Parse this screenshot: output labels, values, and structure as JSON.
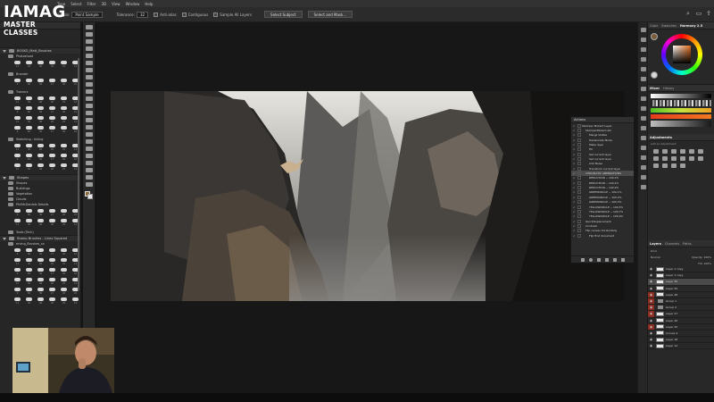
{
  "logo": {
    "line1": "IAMAG",
    "line2": "MASTER CLASSES"
  },
  "menu": [
    "Type",
    "Select",
    "Filter",
    "3D",
    "View",
    "Window",
    "Help"
  ],
  "options_bar": {
    "sample_label": "Sample:",
    "sample_value": "Point Sample",
    "tolerance_label": "Tolerance:",
    "tolerance_value": "32",
    "antialias": "Anti-alias",
    "contiguous": "Contiguous",
    "sample_all": "Sample All Layers",
    "select_subject": "Select Subject",
    "select_mask": "Select and Mask..."
  },
  "brush_panel": {
    "groups": [
      {
        "label": "BOSKO_Matt_Brushes",
        "subs": [
          {
            "label": "Photoshoot",
            "rows": 1
          },
          {
            "label": "Brander",
            "rows": 1
          },
          {
            "label": "Trainers",
            "rows": 4
          },
          {
            "label": "Sketching - Inking",
            "rows": 3
          }
        ]
      },
      {
        "label": "Shapes",
        "subs": [
          {
            "label": "Shapes",
            "rows": 0
          },
          {
            "label": "Buildings",
            "rows": 0
          },
          {
            "label": "Vegetation",
            "rows": 0
          },
          {
            "label": "Clouds",
            "rows": 0
          },
          {
            "label": "PhilMcDaniels Details",
            "rows": 2
          },
          {
            "label": "Tools (Tech)",
            "rows": 0
          }
        ]
      },
      {
        "label": "Stamp Brushes - Lines Squared",
        "subs": [
          {
            "label": "erving_Brushes_xx",
            "rows": 6
          }
        ]
      }
    ],
    "brush_sizes": [
      "11",
      "30",
      "48",
      "20",
      "25",
      "14",
      "9",
      "60",
      "36",
      "17",
      "40",
      "22"
    ]
  },
  "actions_panel": {
    "tab": "Actions",
    "items": [
      {
        "label": "Stamper Mutant Layer",
        "level": 0,
        "on": true
      },
      {
        "label": "StamperMutant.atn",
        "level": 1,
        "on": true
      },
      {
        "label": "Merge Visible",
        "level": 2,
        "on": true
      },
      {
        "label": "Desaturate Mode",
        "level": 2,
        "on": true
      },
      {
        "label": "Make layer",
        "level": 2,
        "on": true
      },
      {
        "label": "Fill",
        "level": 2,
        "on": true
      },
      {
        "label": "Set current layer",
        "level": 2,
        "on": true
      },
      {
        "label": "Set current layer",
        "level": 2,
        "on": true
      },
      {
        "label": "Add Noise",
        "level": 2,
        "on": true
      },
      {
        "label": "Transform current layer",
        "level": 2,
        "on": true
      },
      {
        "label": "CHROMATIC ABERRATIONS",
        "level": 1,
        "on": true,
        "selected": true
      },
      {
        "label": "REDUCTION -- 100,3%",
        "level": 2,
        "on": true
      },
      {
        "label": "REDUCTION -- 100,4%",
        "level": 2,
        "on": true
      },
      {
        "label": "REDUCTION -- 100,9%",
        "level": 2,
        "on": true
      },
      {
        "label": "GREENCIRCLE -- 100,1%",
        "level": 2,
        "on": true
      },
      {
        "label": "GREENCIRCLE -- 100,2%",
        "level": 2,
        "on": true
      },
      {
        "label": "GREENCIRCLE -- 100,3%",
        "level": 2,
        "on": true
      },
      {
        "label": "YELLOWCIRCLE -- 100,5%",
        "level": 2,
        "on": true
      },
      {
        "label": "YELLOWCIRCLE -- 100,7%",
        "level": 2,
        "on": true
      },
      {
        "label": "YELLOWCIRCLE -- 100,9%",
        "level": 2,
        "on": true
      },
      {
        "label": "Quickdisplacement",
        "level": 1,
        "on": true
      },
      {
        "label": "Contrast",
        "level": 1,
        "on": true
      },
      {
        "label": "Flip canvas horizontally",
        "level": 1,
        "on": true
      },
      {
        "label": "Flip first document",
        "level": 2,
        "on": true
      }
    ]
  },
  "right_panels": {
    "color_tabs": [
      "Color",
      "Swatches",
      "Harmony 2.5"
    ],
    "mixer_tabs": [
      "Mixer",
      "History"
    ],
    "adjustments_title": "Adjustments",
    "adjustments_hint": "Add an adjustment",
    "layers_tabs": [
      "Layers",
      "Channels",
      "Paths"
    ],
    "kind_label": "Kind",
    "blend_mode": "Normal",
    "opacity_label": "Opacity:",
    "opacity_value": "100%",
    "fill_label": "Fill:",
    "fill_value": "100%",
    "layers": [
      {
        "name": "Layer 1 copy",
        "type": "layer",
        "red": false,
        "selected": false
      },
      {
        "name": "Layer 1 copy",
        "type": "layer",
        "red": false,
        "selected": false
      },
      {
        "name": "Layer 30",
        "type": "layer",
        "red": false,
        "selected": true
      },
      {
        "name": "Layer 29",
        "type": "layer",
        "red": false,
        "selected": false
      },
      {
        "name": "Layer 28",
        "type": "layer",
        "red": true,
        "selected": false
      },
      {
        "name": "Group 1",
        "type": "group",
        "red": true,
        "selected": false
      },
      {
        "name": "Group 2",
        "type": "group",
        "red": true,
        "selected": false
      },
      {
        "name": "Layer 27",
        "type": "layer",
        "red": true,
        "selected": false
      },
      {
        "name": "Layer 26",
        "type": "layer",
        "red": false,
        "selected": false
      },
      {
        "name": "Layer 25",
        "type": "layer",
        "red": true,
        "selected": false
      },
      {
        "name": "Curves 4",
        "type": "layer",
        "red": false,
        "selected": false
      },
      {
        "name": "Layer 18",
        "type": "layer",
        "red": false,
        "selected": false
      },
      {
        "name": "Layer 12",
        "type": "layer",
        "red": false,
        "selected": false
      }
    ]
  },
  "colors": {
    "ui_dark": "#262626",
    "accent_orange": "#e06a1a",
    "layer_mark_red": "#8c2f22"
  }
}
